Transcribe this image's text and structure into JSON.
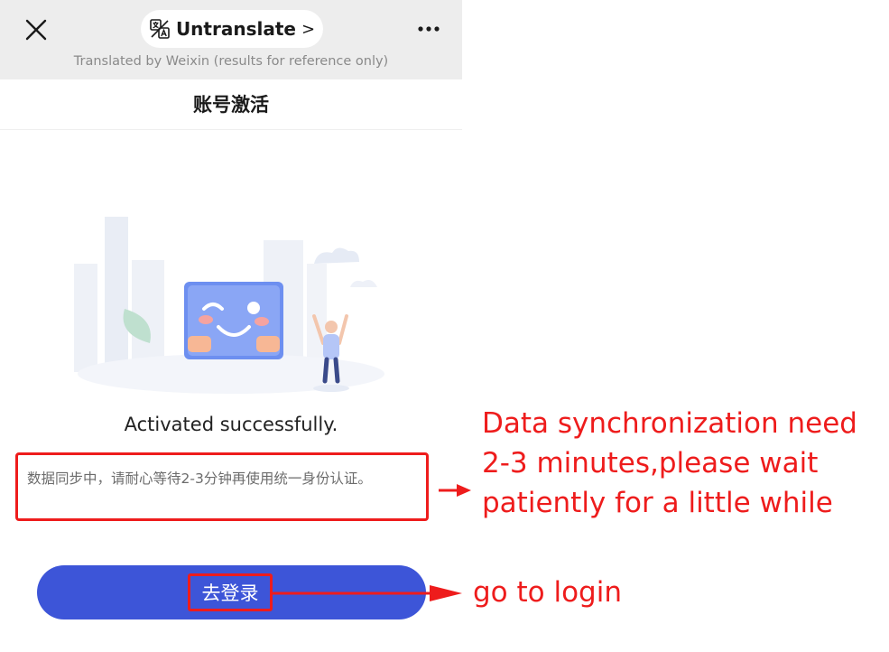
{
  "topbar": {
    "close_icon": "close-icon",
    "translate_icon": "translate-icon",
    "translate_label": "Untranslate",
    "translate_chevron": ">",
    "more_icon": "more-icon",
    "note": "Translated by Weixin (results for reference only)"
  },
  "page": {
    "title": "账号激活",
    "status": "Activated successfully.",
    "notice": "数据同步中，请耐心等待2-3分钟再使用统一身份认证。",
    "login_button": "去登录"
  },
  "annotations": {
    "sync_note": "Data synchronization need 2-3 minutes,please wait patiently for a little while",
    "login_note": "go to login"
  },
  "colors": {
    "accent_blue": "#3d55d8",
    "annotation_red": "#ee1c1c",
    "topbar_bg": "#ededed"
  }
}
